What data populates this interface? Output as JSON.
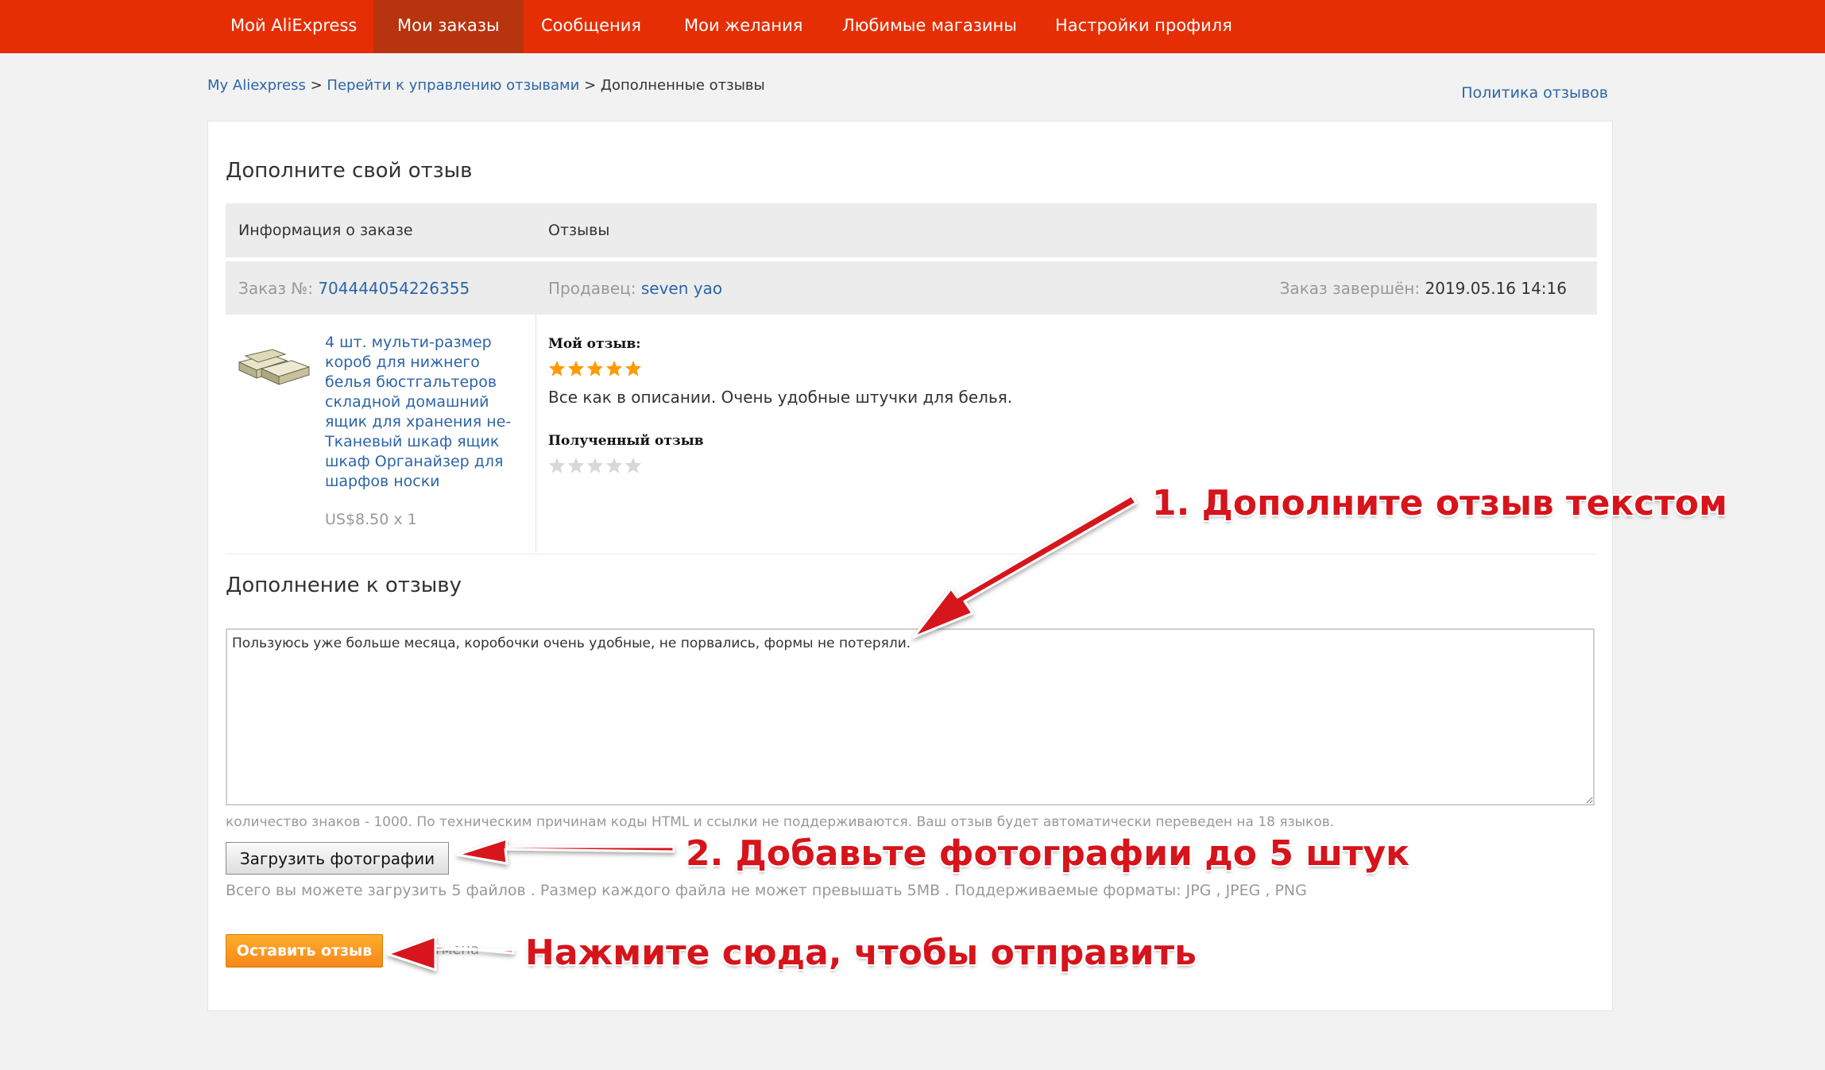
{
  "nav": {
    "items": [
      {
        "label": "Мой AliExpress"
      },
      {
        "label": "Мои заказы",
        "active": true
      },
      {
        "label": "Сообщения"
      },
      {
        "label": "Мои желания"
      },
      {
        "label": "Любимые магазины"
      },
      {
        "label": "Настройки профиля"
      }
    ]
  },
  "breadcrumb": {
    "home": "My Aliexpress",
    "sep1": " > ",
    "manage": "Перейти к управлению отзывами",
    "sep2": " > ",
    "current": "Дополненные отзывы"
  },
  "policy_link": "Политика отзывов",
  "page_title": "Дополните свой отзыв",
  "table": {
    "col_order_info": "Информация о заказе",
    "col_reviews": "Отзывы"
  },
  "order": {
    "number_label": "Заказ №: ",
    "number": "704444054226355",
    "seller_label": "Продавец: ",
    "seller": "seven yao",
    "completed_label": "Заказ завершён: ",
    "completed": "2019.05.16 14:16"
  },
  "product": {
    "title": "4 шт. мульти-размер короб для нижнего белья бюстгальтеров складной домашний ящик для хранения не-Тканевый шкаф ящик шкаф Органайзер для шарфов носки",
    "price": "US$8.50 x 1"
  },
  "my_review": {
    "label": "Мой отзыв:",
    "rating": 5,
    "text": "Все как в описании. Очень удобные штучки для белья."
  },
  "received_review": {
    "label": "Полученный отзыв",
    "rating": 0
  },
  "supplement": {
    "title": "Дополнение к отзыву",
    "value": "Пользуюсь уже больше месяца, коробочки очень удобные, не порвались, формы не потеряли.",
    "char_hint": "количество знаков - 1000. По техническим причинам коды HTML и ссылки не поддерживаются. Ваш отзыв будет автоматически переведен на 18 языков."
  },
  "upload": {
    "button": "Загрузить фотографии",
    "hint": "Всего вы можете загрузить 5 файлов . Размер каждого файла не может превышать 5MB . Поддерживаемые форматы: JPG , JPEG , PNG"
  },
  "submit_button": "Оставить отзыв",
  "cancel_link": "Отмена",
  "annotations": {
    "step1": "1. Дополните отзыв текстом",
    "step2": "2. Добавьте фотографии до 5 штук",
    "step3": "Нажмите сюда, чтобы отправить"
  },
  "colors": {
    "nav_bg": "#e62e04",
    "nav_active": "#b8340f",
    "link": "#2d65a8",
    "star_filled": "#ff9a00",
    "star_empty": "#d8d8d8",
    "submit": "#f7871a",
    "annotation": "#d6141b"
  }
}
